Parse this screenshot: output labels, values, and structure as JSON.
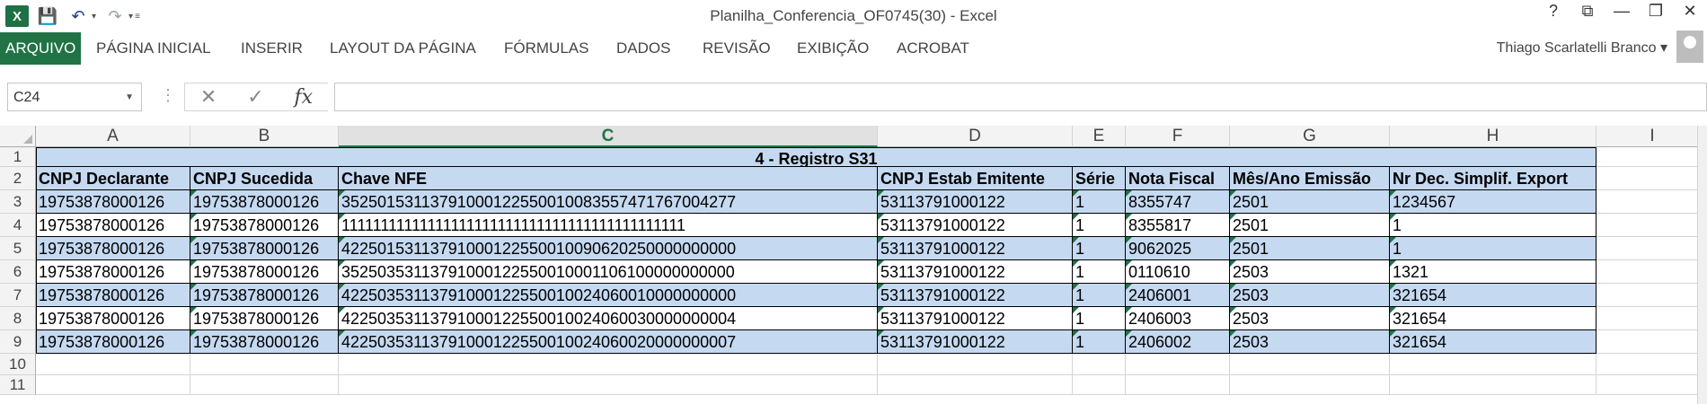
{
  "window": {
    "title": "Planilha_Conferencia_OF0745(30) - Excel",
    "logo_text": "X",
    "controls": [
      "?",
      "⧉",
      "—",
      "❐",
      "✕"
    ]
  },
  "ribbon": {
    "tabs": [
      "ARQUIVO",
      "PÁGINA INICIAL",
      "INSERIR",
      "LAYOUT DA PÁGINA",
      "FÓRMULAS",
      "DADOS",
      "REVISÃO",
      "EXIBIÇÃO",
      "ACROBAT"
    ],
    "active_tab": "ARQUIVO",
    "user": "Thiago Scarlatelli Branco ▾"
  },
  "formula_bar": {
    "name_box": "C24",
    "fx": "fx",
    "formula": ""
  },
  "sheet": {
    "columns": [
      "A",
      "B",
      "C",
      "D",
      "E",
      "F",
      "G",
      "H",
      "I"
    ],
    "selected_column": "C",
    "row_numbers": [
      "1",
      "2",
      "3",
      "4",
      "5",
      "6",
      "7",
      "8",
      "9",
      "10",
      "11"
    ],
    "title": "4 - Registro S31",
    "headers": [
      "CNPJ Declarante",
      "CNPJ Sucedida",
      "Chave NFE",
      "CNPJ Estab Emitente",
      "Série",
      "Nota Fiscal",
      "Mês/Ano Emissão",
      "Nr Dec. Simplif. Export"
    ],
    "rows": [
      [
        "19753878000126",
        "19753878000126",
        "35250153113791000122550010083557471767004277",
        "53113791000122",
        "1",
        "8355747",
        "2501",
        "1234567"
      ],
      [
        "19753878000126",
        "19753878000126",
        "11111111111111111111111111111111111111111111",
        "53113791000122",
        "1",
        "8355817",
        "2501",
        "1"
      ],
      [
        "19753878000126",
        "19753878000126",
        "42250153113791000122550010090620250000000000",
        "53113791000122",
        "1",
        "9062025",
        "2501",
        "1"
      ],
      [
        "19753878000126",
        "19753878000126",
        "35250353113791000122550010001106100000000000",
        "53113791000122",
        "1",
        "0110610",
        "2503",
        "1321"
      ],
      [
        "19753878000126",
        "19753878000126",
        "42250353113791000122550010024060010000000000",
        "53113791000122",
        "1",
        "2406001",
        "2503",
        "321654"
      ],
      [
        "19753878000126",
        "19753878000126",
        "42250353113791000122550010024060030000000004",
        "53113791000122",
        "1",
        "2406003",
        "2503",
        "321654"
      ],
      [
        "19753878000126",
        "19753878000126",
        "42250353113791000122550010024060020000000007",
        "53113791000122",
        "1",
        "2406002",
        "2503",
        "321654"
      ]
    ]
  }
}
